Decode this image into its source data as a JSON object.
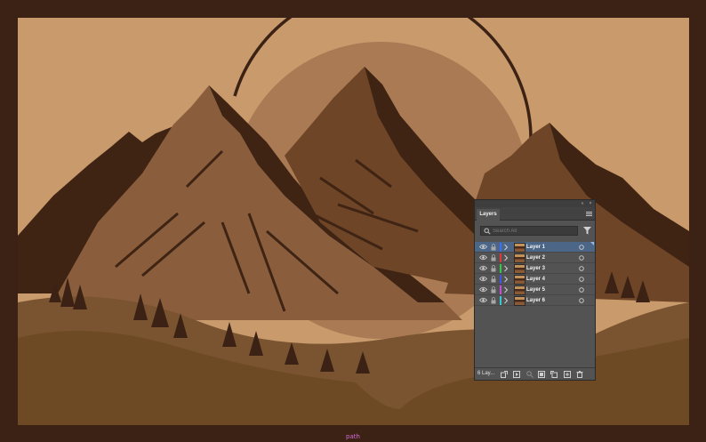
{
  "artwork": {
    "colors": {
      "frame": "#3b2214",
      "sky": "#c89a6c",
      "sun": "#a97a54",
      "sun_outline": "#3b2214",
      "mountain_light": "#8a5e3d",
      "mountain_mid": "#6e4527",
      "mountain_dark": "#3f2414",
      "foreground": "#6e4a24",
      "foreground_light": "#7a5430",
      "trees": "#3b2214"
    }
  },
  "layers_panel": {
    "tab_label": "Layers",
    "search_placeholder": "Search All",
    "layer_count_label": "6 Lay...",
    "layers": [
      {
        "name": "Layer 1",
        "color": "#3e6ff2",
        "selected": true
      },
      {
        "name": "Layer 2",
        "color": "#e8333b",
        "selected": false
      },
      {
        "name": "Layer 3",
        "color": "#34c84a",
        "selected": false
      },
      {
        "name": "Layer 4",
        "color": "#3d58e6",
        "selected": false
      },
      {
        "name": "Layer 5",
        "color": "#c24fd9",
        "selected": false
      },
      {
        "name": "Layer 6",
        "color": "#34c9d1",
        "selected": false
      }
    ],
    "icons": {
      "visibility": "eye-icon",
      "lock": "lock-icon",
      "expand": "chevron-right-icon",
      "target": "target-circle-icon",
      "search": "search-icon",
      "filter": "filter-icon",
      "menu": "panel-menu-icon"
    }
  },
  "status_bar": {
    "selection_type": "path"
  }
}
